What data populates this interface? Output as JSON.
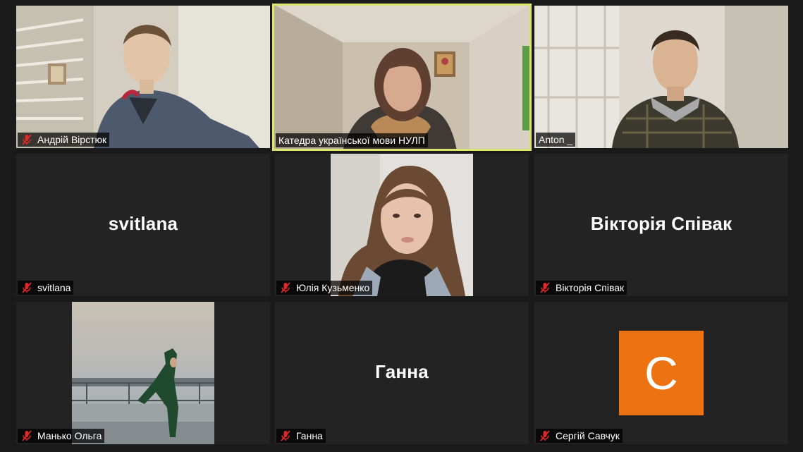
{
  "participants": [
    {
      "name": "Андрій Вірстюк",
      "muted": true,
      "video": true
    },
    {
      "name": "Катедра української мови НУЛП",
      "muted": false,
      "video": true,
      "active_speaker": true
    },
    {
      "name": "Anton _",
      "muted": false,
      "video": true
    },
    {
      "name": "svitlana",
      "muted": true,
      "video": false,
      "display_text": "svitlana"
    },
    {
      "name": "Юлія Кузьменко",
      "muted": true,
      "video": true
    },
    {
      "name": "Вікторія Співак",
      "muted": true,
      "video": false,
      "display_text": "Вікторія Співак"
    },
    {
      "name": "Манько Ольга",
      "muted": true,
      "video": true
    },
    {
      "name": "Ганна",
      "muted": true,
      "video": false,
      "display_text": "Ганна"
    },
    {
      "name": "Сергій Савчук",
      "muted": true,
      "video": false,
      "avatar_letter": "C"
    }
  ],
  "colors": {
    "background": "#1a1a1a",
    "tile": "#232323",
    "active_border": "#dbe56f",
    "muted_icon": "#e02828",
    "avatar": "#ec7212"
  },
  "icons": {
    "muted": "microphone-muted-icon"
  }
}
